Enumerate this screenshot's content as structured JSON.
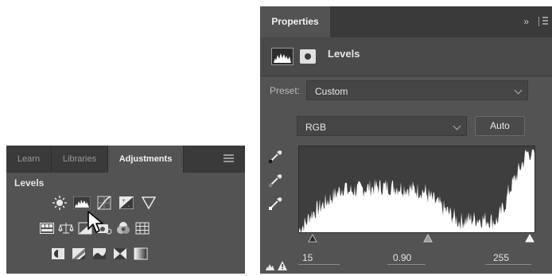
{
  "adjustments_panel": {
    "tabs": [
      {
        "label": "Learn",
        "active": false
      },
      {
        "label": "Libraries",
        "active": false
      },
      {
        "label": "Adjustments",
        "active": true
      }
    ],
    "title": "Levels",
    "icons": [
      [
        "brightness-contrast-icon",
        "levels-icon",
        "curves-icon",
        "exposure-icon",
        "vibrance-icon"
      ],
      [
        "hue-saturation-icon",
        "color-balance-icon",
        "black-white-icon",
        "photo-filter-icon",
        "channel-mixer-icon",
        "color-lookup-icon"
      ],
      [
        "invert-icon",
        "posterize-icon",
        "threshold-icon",
        "selective-color-icon",
        "gradient-map-icon"
      ]
    ]
  },
  "properties_panel": {
    "tab_label": "Properties",
    "collapse_glyph": "»",
    "title": "Levels",
    "preset_label": "Preset:",
    "preset_value": "Custom",
    "channel_value": "RGB",
    "auto_label": "Auto",
    "input_values": {
      "shadows": "15",
      "midtones": "0.90",
      "highlights": "255"
    }
  },
  "colors": {
    "panel_bg": "#535353",
    "tab_bar": "#3a3a3a",
    "histogram_bg": "#3e3e3e",
    "histogram_fill": "#ffffff"
  }
}
